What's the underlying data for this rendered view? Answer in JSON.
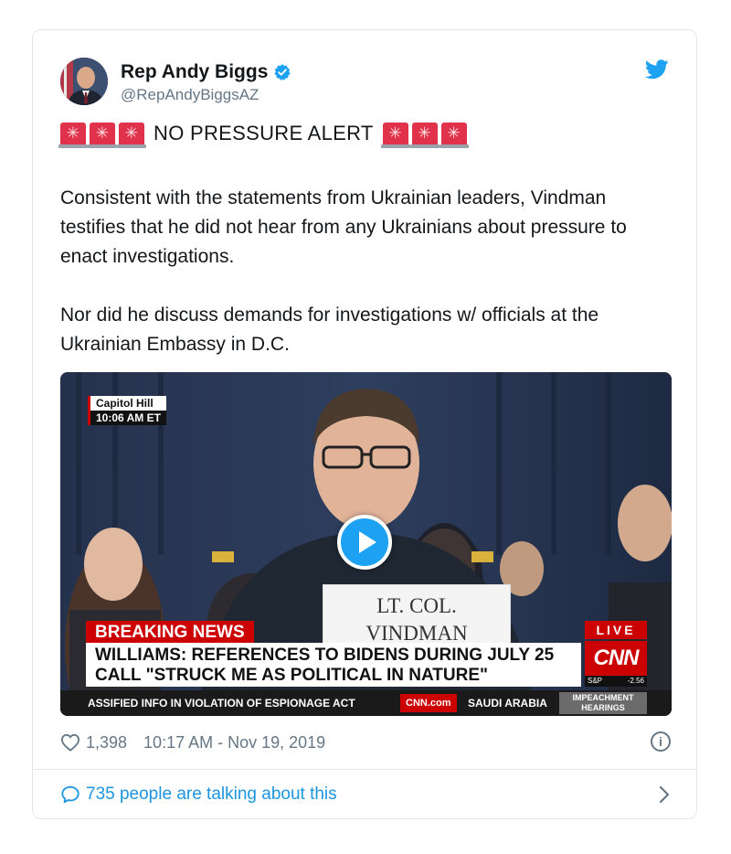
{
  "author": {
    "name": "Rep Andy Biggs",
    "handle": "@RepAndyBiggsAZ",
    "verified_icon": "verified-badge-icon",
    "avatar_icon": "avatar"
  },
  "tweet": {
    "alert_text": "NO PRESSURE ALERT",
    "paragraph_1": "Consistent with the statements from Ukrainian leaders, Vindman testifies that he did not hear from any Ukrainians about pressure to enact investigations.",
    "paragraph_2": "Nor did he discuss demands for investigations w/ officials at the Ukrainian Embassy in D.C."
  },
  "video": {
    "location": "Capitol Hill",
    "location_time": "10:06 AM ET",
    "nameplate_line1": "LT. COL.",
    "nameplate_line2": "VINDMAN",
    "breaking_label": "BREAKING NEWS",
    "headline": "WILLIAMS: REFERENCES TO BIDENS DURING JULY 25 CALL \"STRUCK ME AS POLITICAL IN NATURE\"",
    "live_label": "LIVE",
    "network_logo": "CNN",
    "market_label": "S&P",
    "market_value": "-2.56",
    "ticker_text": "ASSIFIED INFO IN VIOLATION OF ESPIONAGE ACT",
    "ticker_site": "CNN.com",
    "ticker_text_2": "SAUDI ARABIA",
    "ticker_tag_1": "IMPEACHMENT",
    "ticker_tag_2": "HEARINGS"
  },
  "meta": {
    "likes": "1,398",
    "timestamp": "10:17 AM - Nov 19, 2019",
    "info_glyph": "i"
  },
  "footer": {
    "talking_text": "735 people are talking about this"
  },
  "colors": {
    "brand_blue": "#1da1f2",
    "link_blue": "#1b95e0",
    "siren_red": "#e0324a",
    "cnn_red": "#cc0000"
  }
}
